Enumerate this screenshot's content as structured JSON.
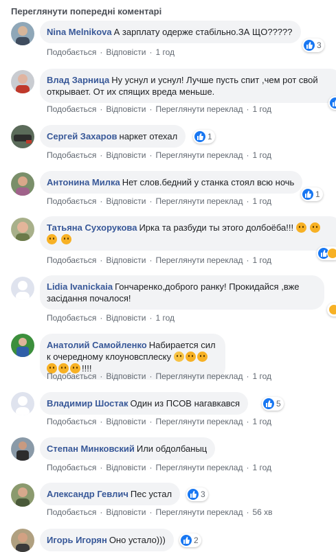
{
  "prev_comments_label": "Переглянути попередні коментарі",
  "labels": {
    "like": "Подобається",
    "reply": "Відповісти",
    "translate": "Переглянути переклад",
    "sep": "·"
  },
  "colors": {
    "author": "#385898",
    "bubble": "#f2f3f5",
    "like_blue": "#1877f2",
    "meta": "#606770"
  },
  "comments": [
    {
      "author": "Nina Melnikova",
      "text": "А зарплату одерже стабільно.ЗА ЩО?????",
      "reactions": "3",
      "time": "1 год"
    },
    {
      "author": "Влад Зарница",
      "text": "Ну уснул и уснул! Лучше пусть спит ,чем рот свой открывает. От их спящих вреда меньше.",
      "reactions": "",
      "time": "1 год"
    },
    {
      "author": "Сергей Захаров",
      "text": "наркет отехал",
      "reactions": "1",
      "time": "1 год"
    },
    {
      "author": "Антонина Милка",
      "text": "Нет слов.бедний у станка стоял всю ночь",
      "reactions": "1",
      "time": "1 год"
    },
    {
      "author": "Татьяна Сухорукова",
      "text": "Ирка та разбуди ты этого долбоёба!!!",
      "reactions": "",
      "time": "1 год"
    },
    {
      "author": "Lidia Ivanickaia",
      "text": "Гончаренко,доброго ранку! Прокидайся ,вже засідання почалося!",
      "reactions": "",
      "time": "1 год"
    },
    {
      "author": "Анатолий Самойленко",
      "text": "Набирается сил к очередному клоунов­сплеску",
      "suffix": "!!!!",
      "reactions": "",
      "time": "1 год"
    },
    {
      "author": "Владимир Шостак",
      "text": "Один из ПСОВ нагавкався",
      "reactions": "5",
      "time": "1 год"
    },
    {
      "author": "Степан Минковский",
      "text": "Или обдолбаныц",
      "reactions": "",
      "time": "1 год"
    },
    {
      "author": "Александр Гевлич",
      "text": "Пес устал",
      "reactions": "3",
      "time": "56 хв"
    },
    {
      "author": "Игорь Игорян",
      "text": "Оно устало)))",
      "reactions": "2",
      "time": ""
    }
  ]
}
